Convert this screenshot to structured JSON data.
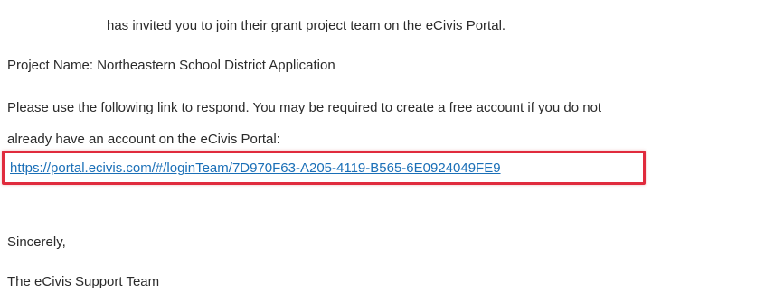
{
  "email": {
    "intro_line": "has invited you to join their grant project team on the eCivis Portal.",
    "project_line": "Project Name: Northeastern School District Application",
    "instructions_line_1": "Please use the following link to respond. You may be required to create a free account if you do not",
    "instructions_line_2": "already have an account on the eCivis Portal:",
    "link_text": "https://portal.ecivis.com/#/loginTeam/7D970F63-A205-4119-B565-6E0924049FE9",
    "closing": "Sincerely,",
    "signature": "The eCivis Support Team"
  },
  "highlight_color": "#e02b3d",
  "link_color": "#1a6fb7"
}
